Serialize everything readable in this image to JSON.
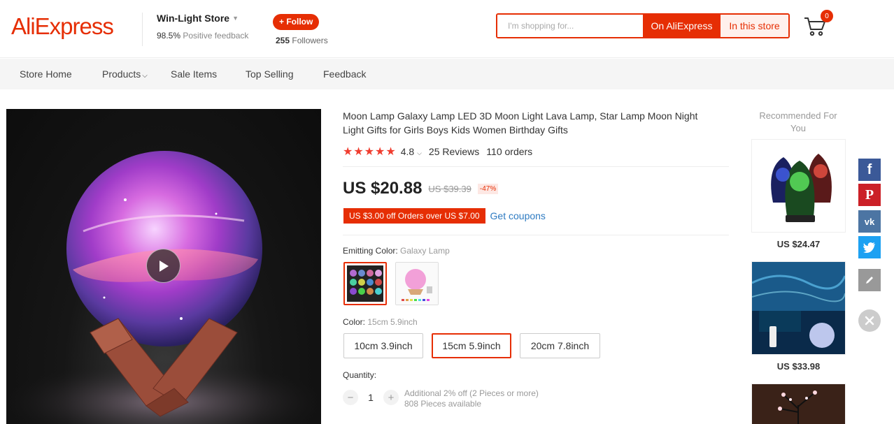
{
  "header": {
    "logo": "AliExpress",
    "store_name": "Win-Light Store",
    "positive_feedback_value": "98.5%",
    "positive_feedback_label": "Positive feedback",
    "follow_label": "+ Follow",
    "followers_count": "255",
    "followers_label": "Followers",
    "search_placeholder": "I'm shopping for...",
    "search_aliexpress_label": "On AliExpress",
    "search_store_label": "In this store",
    "cart_count": "0"
  },
  "nav": {
    "items": [
      "Store Home",
      "Products",
      "Sale Items",
      "Top Selling",
      "Feedback"
    ]
  },
  "product": {
    "title": "Moon Lamp Galaxy Lamp LED 3D Moon Light Lava Lamp, Star Lamp Moon Night Light Gifts for Girls Boys Kids Women Birthday Gifts",
    "rating": "4.8",
    "stars": 5,
    "reviews": "25 Reviews",
    "orders": "110 orders",
    "price": "US $20.88",
    "original_price": "US $39.39",
    "discount": "-47%",
    "coupon": "US $3.00 off Orders over US $7.00",
    "get_coupons": "Get coupons",
    "emitting_color_label": "Emitting Color:",
    "emitting_color_value": "Galaxy Lamp",
    "color_label": "Color:",
    "color_value": "15cm 5.9inch",
    "sizes": [
      "10cm 3.9inch",
      "15cm 5.9inch",
      "20cm 7.8inch"
    ],
    "selected_size_index": 1,
    "quantity_label": "Quantity:",
    "quantity": "1",
    "quantity_note_1": "Additional 2% off (2 Pieces or more)",
    "quantity_note_2": "808 Pieces available"
  },
  "recommended": {
    "heading": "Recommended For You",
    "items": [
      {
        "price": "US $24.47"
      },
      {
        "price": "US $33.98"
      }
    ]
  },
  "share": {
    "icons": [
      "facebook-icon",
      "pinterest-icon",
      "vk-icon",
      "twitter-icon",
      "edit-icon",
      "close-icon"
    ],
    "colors": {
      "facebook": "#3b5998",
      "pinterest": "#cb2027",
      "vk": "#4c75a3",
      "twitter": "#1da1f2",
      "edit": "#999999"
    }
  },
  "colors": {
    "brand": "#e62e04",
    "link": "#2e7bc2"
  }
}
